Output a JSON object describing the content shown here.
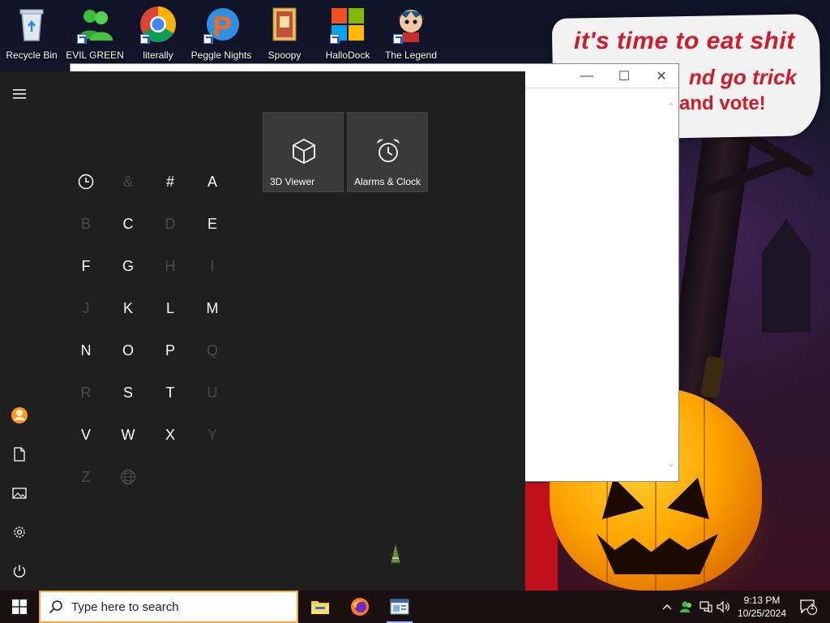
{
  "desktop": {
    "icons": [
      {
        "label": "Recycle Bin",
        "icon": "recycle-bin-icon"
      },
      {
        "label": "EVIL GREEN",
        "icon": "people-icon"
      },
      {
        "label": "literally",
        "icon": "chrome-icon"
      },
      {
        "label": "Peggle Nights",
        "icon": "peggle-icon"
      },
      {
        "label": "Spoopy",
        "icon": "folder-icon"
      },
      {
        "label": "HalloDock",
        "icon": "windows-logo-icon"
      },
      {
        "label": "The Legend",
        "icon": "character-icon"
      }
    ],
    "wallpaper_text": {
      "line1": "it's time to eat shit",
      "line2": "nd go trick",
      "line3": "and vote!"
    }
  },
  "background_window": {
    "controls": {
      "minimize": "—",
      "maximize": "☐",
      "close": "✕"
    }
  },
  "start_menu": {
    "rail": [
      "menu-icon",
      "user-avatar",
      "documents-icon",
      "pictures-icon",
      "settings-icon",
      "power-icon"
    ],
    "letters": [
      {
        "label": "recent",
        "enabled": true
      },
      {
        "label": "&",
        "enabled": false
      },
      {
        "label": "#",
        "enabled": true
      },
      {
        "label": "A",
        "enabled": true
      },
      {
        "label": "B",
        "enabled": false
      },
      {
        "label": "C",
        "enabled": true
      },
      {
        "label": "D",
        "enabled": false
      },
      {
        "label": "E",
        "enabled": true
      },
      {
        "label": "F",
        "enabled": true
      },
      {
        "label": "G",
        "enabled": true
      },
      {
        "label": "H",
        "enabled": false
      },
      {
        "label": "I",
        "enabled": false
      },
      {
        "label": "J",
        "enabled": false
      },
      {
        "label": "K",
        "enabled": true
      },
      {
        "label": "L",
        "enabled": true
      },
      {
        "label": "M",
        "enabled": true
      },
      {
        "label": "N",
        "enabled": true
      },
      {
        "label": "O",
        "enabled": true
      },
      {
        "label": "P",
        "enabled": true
      },
      {
        "label": "Q",
        "enabled": false
      },
      {
        "label": "R",
        "enabled": false
      },
      {
        "label": "S",
        "enabled": true
      },
      {
        "label": "T",
        "enabled": true
      },
      {
        "label": "U",
        "enabled": false
      },
      {
        "label": "V",
        "enabled": true
      },
      {
        "label": "W",
        "enabled": true
      },
      {
        "label": "X",
        "enabled": true
      },
      {
        "label": "Y",
        "enabled": false
      },
      {
        "label": "Z",
        "enabled": false
      },
      {
        "label": "globe",
        "enabled": false
      }
    ],
    "tiles": [
      {
        "label": "3D Viewer",
        "icon": "cube-icon"
      },
      {
        "label": "Alarms & Clock",
        "icon": "alarm-clock-icon"
      }
    ]
  },
  "taskbar": {
    "search_placeholder": "Type here to search",
    "pinned": [
      "file-explorer-icon",
      "firefox-icon",
      "app-window-icon"
    ],
    "tray": {
      "time": "9:13 PM",
      "date": "10/25/2024",
      "notification_count": "1"
    }
  },
  "colors": {
    "start_menu_bg": "#1f1f1f",
    "tile_bg": "#3a3a3a",
    "disabled_letter": "#4b4b4b",
    "search_border": "#f0a84a",
    "speech_text": "#d11a2a"
  }
}
